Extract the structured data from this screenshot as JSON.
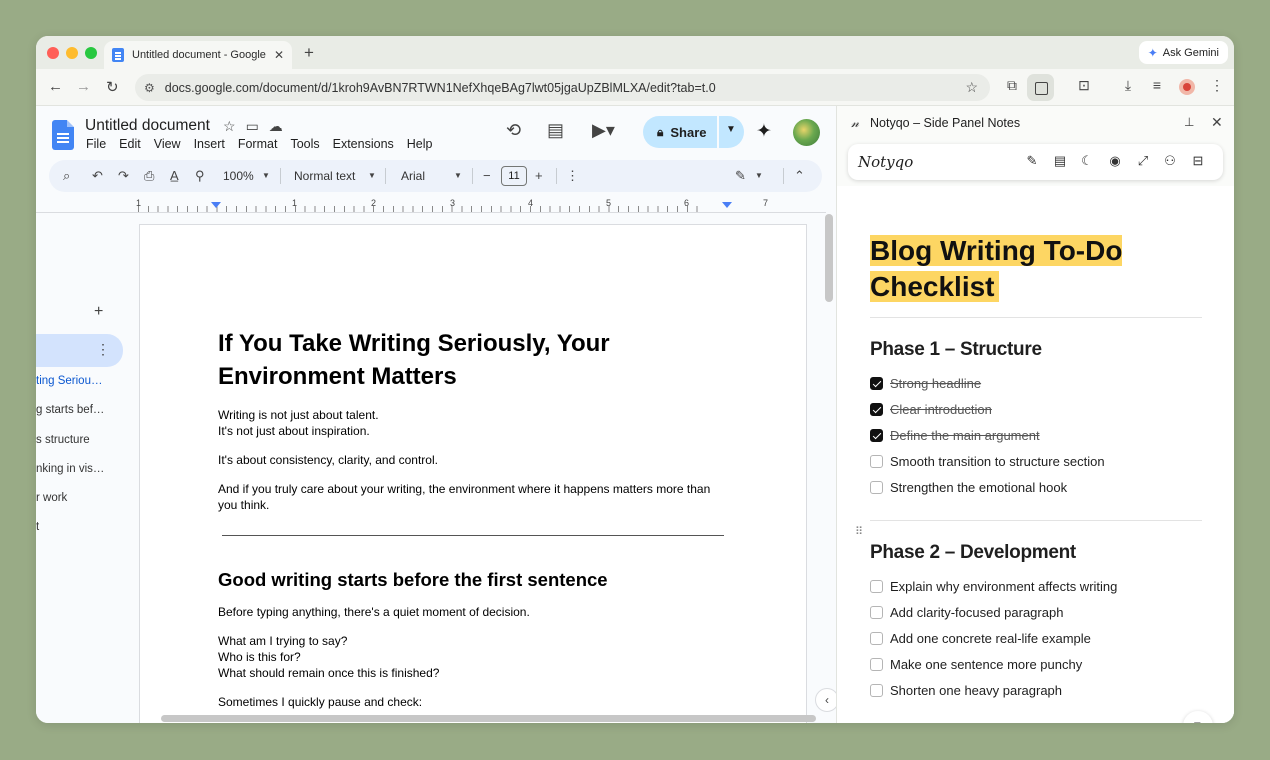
{
  "browser": {
    "tab_title": "Untitled document - Google D",
    "new_tab": "+",
    "ask_gemini": "Ask Gemini",
    "url": "docs.google.com/document/d/1kroh9AvBN7RTWN1NefXhqeBAg7lwt05jgaUpZBlMLXA/edit?tab=t.0",
    "traffic_colors": [
      "#ff5f57",
      "#febc2e",
      "#28c840"
    ]
  },
  "docs": {
    "title": "Untitled document",
    "menu": [
      "File",
      "Edit",
      "View",
      "Insert",
      "Format",
      "Tools",
      "Extensions",
      "Help"
    ],
    "share_label": "Share",
    "toolbar": {
      "zoom": "100%",
      "style": "Normal text",
      "font": "Arial",
      "font_size": "11",
      "minus": "−",
      "plus": "+"
    },
    "ruler_numbers": [
      "1",
      "1",
      "2",
      "3",
      "4",
      "5",
      "6",
      "7"
    ],
    "outline": {
      "add": "+",
      "items": [
        "ting Seriou…",
        "g starts bef…",
        "s structure",
        "nking in vis…",
        "r work",
        "t"
      ]
    },
    "page": {
      "heading1": "If You Take Writing Seriously, Your Environment Matters",
      "p1": "Writing is not just about talent.\n It's not just about inspiration.",
      "p2": "It's about consistency, clarity, and control.",
      "p3": "And if you truly care about your writing, the environment where it happens matters more than you think.",
      "heading2": "Good writing starts before the first sentence",
      "p4": "Before typing anything, there's a quiet moment of decision.",
      "p5": "What am I trying to say?\n Who is this for?\n What should remain once this is finished?",
      "p6": "Sometimes I quickly pause and check:"
    }
  },
  "sidepanel": {
    "header_title": "Notyqo – Side Panel Notes",
    "brand": "Notyqo",
    "note_title": "Blog Writing To-Do Checklist",
    "highlight_color": "#fdd663",
    "phases": [
      {
        "title": "Phase 1 – Structure",
        "items": [
          {
            "label": "Strong headline",
            "checked": true
          },
          {
            "label": "Clear introduction",
            "checked": true
          },
          {
            "label": "Define the main argument",
            "checked": true
          },
          {
            "label": "Smooth transition to structure section",
            "checked": false
          },
          {
            "label": "Strengthen the emotional hook",
            "checked": false
          }
        ]
      },
      {
        "title": "Phase 2 – Development",
        "items": [
          {
            "label": "Explain why environment affects writing",
            "checked": false
          },
          {
            "label": "Add clarity-focused paragraph",
            "checked": false
          },
          {
            "label": "Add one concrete real-life example",
            "checked": false
          },
          {
            "label": "Make one sentence more punchy",
            "checked": false
          },
          {
            "label": "Shorten one heavy paragraph",
            "checked": false
          }
        ]
      }
    ]
  }
}
